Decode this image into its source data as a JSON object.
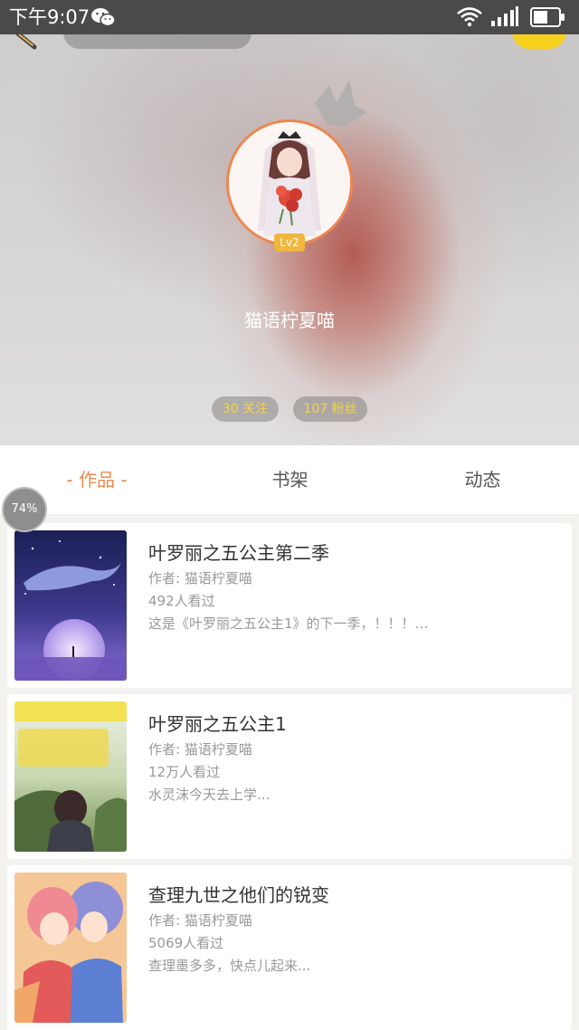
{
  "status_bar": {
    "time": "下午9:07",
    "icons": [
      "wechat-icon",
      "wifi-icon",
      "signal-icon",
      "battery-icon"
    ]
  },
  "profile": {
    "username": "猫语柠夏喵",
    "level": "Lv2",
    "following": "30 关注",
    "fans": "107 粉丝",
    "avatar_border_color": "#ee8650"
  },
  "tabs": [
    {
      "label": "- 作品 -",
      "active": true
    },
    {
      "label": "书架",
      "active": false
    },
    {
      "label": "动态",
      "active": false
    }
  ],
  "progress": "74%",
  "works": [
    {
      "title": "叶罗丽之五公主第二季",
      "author": "作者: 猫语柠夏喵",
      "views": "492人看过",
      "desc": "这是《叶罗丽之五公主1》的下一季，！！！…"
    },
    {
      "title": "叶罗丽之五公主1",
      "author": "作者: 猫语柠夏喵",
      "views": "12万人看过",
      "desc": "水灵沫今天去上学..."
    },
    {
      "title": "查理九世之他们的锐变",
      "author": "作者: 猫语柠夏喵",
      "views": "5069人看过",
      "desc": "查理墨多多，快点儿起来..."
    }
  ],
  "colors": {
    "accent": "#ec8a4f",
    "highlight_yellow": "#f7d21c",
    "stat_text": "#f2d44e"
  }
}
